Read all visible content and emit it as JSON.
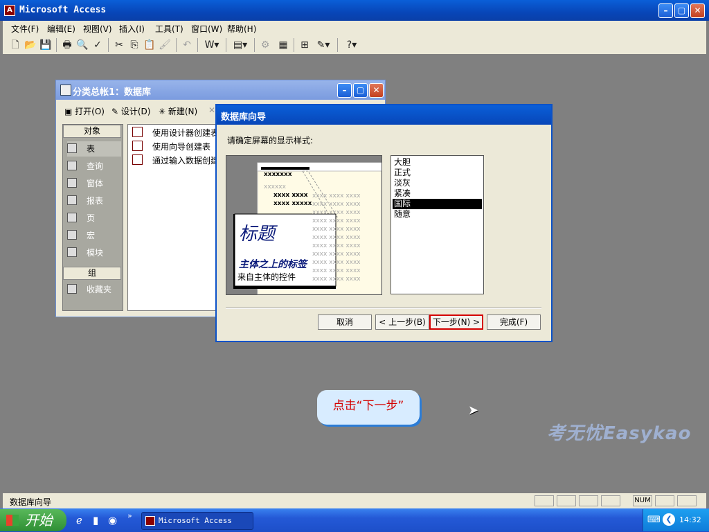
{
  "app": {
    "title": "Microsoft Access"
  },
  "menu": [
    "文件(F)",
    "编辑(E)",
    "视图(V)",
    "插入(I)",
    "工具(T)",
    "窗口(W)",
    "帮助(H)"
  ],
  "db_window": {
    "title": "分类总帐1：数据库",
    "toolbar": {
      "open": "打开(O)",
      "design": "设计(D)",
      "new": "新建(N)"
    },
    "objects_header": "对象",
    "objects": [
      "表",
      "查询",
      "窗体",
      "报表",
      "页",
      "宏",
      "模块"
    ],
    "groups_header": "组",
    "favorites": "收藏夹",
    "items": [
      "使用设计器创建表",
      "使用向导创建表",
      "通过输入数据创建"
    ]
  },
  "wizard": {
    "title": "数据库向导",
    "prompt": "请确定屏幕的显示样式:",
    "preview": {
      "heading": "标题",
      "label": "主体之上的标签",
      "control": "来自主体的控件",
      "sample1": "xxxxxxx",
      "sample2": "xxxxxx",
      "sample3": "xxxx xxxx",
      "sample4": "xxxx xxxxx"
    },
    "styles": [
      "大胆",
      "正式",
      "淡灰",
      "紧凑",
      "国际",
      "随意"
    ],
    "selected_style": "国际",
    "buttons": {
      "cancel": "取消",
      "back": "< 上一步(B)",
      "next": "下一步(N) >",
      "finish": "完成(F)"
    }
  },
  "callout": "点击“下一步”",
  "watermark": "考无忧Easykao",
  "status": {
    "text": "数据库向导",
    "num": "NUM"
  },
  "taskbar": {
    "start": "开始",
    "app": "Microsoft Access",
    "clock": "14:32"
  }
}
